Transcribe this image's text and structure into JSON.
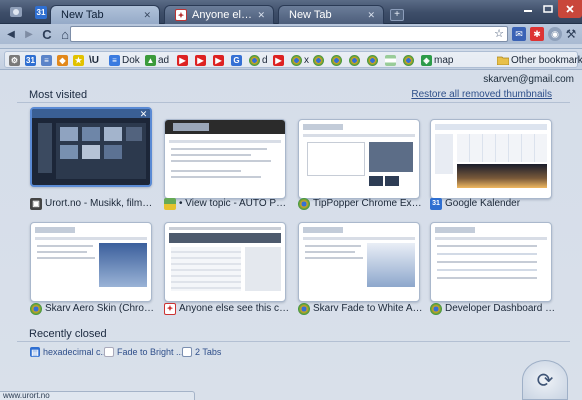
{
  "window": {
    "tabs": [
      {
        "title": "New Tab",
        "active": true,
        "favicon": "new-tab"
      },
      {
        "title": "Anyone else see this...",
        "active": false,
        "favicon": "news"
      },
      {
        "title": "New Tab",
        "active": false,
        "favicon": "new-tab"
      }
    ],
    "new_tab_glyph": "+",
    "app_badge": "31"
  },
  "toolbar": {
    "back": "◀",
    "forward": "▶",
    "reload": "C",
    "home": "⌂",
    "omnibox_value": "",
    "star": "☆",
    "wrench": "⚒"
  },
  "bookmarks": [
    {
      "label": "",
      "icon": "gear-icon",
      "color": "#7a7a7a"
    },
    {
      "label": "",
      "icon": "calendar-icon",
      "color": "#2f6fd1"
    },
    {
      "label": "",
      "icon": "docs-icon",
      "color": "#5b84c9"
    },
    {
      "label": "",
      "icon": "orange-icon",
      "color": "#e2881b"
    },
    {
      "label": "",
      "icon": "star-icon",
      "color": "#e2c200"
    },
    {
      "label": "\\U",
      "icon": "",
      "color": ""
    },
    {
      "label": "Dok",
      "icon": "docs-icon",
      "color": "#3a7be0"
    },
    {
      "label": "ad",
      "icon": "ads-icon",
      "color": "#3b9b3b"
    },
    {
      "label": "",
      "icon": "youtube-icon",
      "color": "#d22"
    },
    {
      "label": "",
      "icon": "youtube-icon",
      "color": "#d22"
    },
    {
      "label": "",
      "icon": "youtube-icon",
      "color": "#d22"
    },
    {
      "label": "",
      "icon": "google-icon",
      "color": "#3570d4"
    },
    {
      "label": "d",
      "icon": "chrome-icon",
      "color": "#e2a51b"
    },
    {
      "label": "",
      "icon": "youtube-icon",
      "color": "#d22"
    },
    {
      "label": "x",
      "icon": "chrome-icon",
      "color": "#2d9b49"
    },
    {
      "label": "",
      "icon": "chrome-icon",
      "color": "#2d9b49"
    },
    {
      "label": "",
      "icon": "chrome-icon",
      "color": "#2d9b49"
    },
    {
      "label": "",
      "icon": "chrome-icon",
      "color": "#2d9b49"
    },
    {
      "label": "",
      "icon": "flag-icon",
      "color": "#9c9"
    },
    {
      "label": "",
      "icon": "chrome-icon",
      "color": "#2d9b49"
    },
    {
      "label": "map",
      "icon": "maps-icon",
      "color": "#2d9b49"
    }
  ],
  "other_bookmarks_label": "Other bookmarks",
  "account_email": "skarven@gmail.com",
  "most_visited": {
    "title": "Most visited",
    "restore_label": "Restore all removed thumbnails",
    "items": [
      {
        "title": "Urort.no - Musikk, filmmusikk...",
        "favicon_color": "#444"
      },
      {
        "title": "• View topic - AUTO POP-UP...",
        "favicon_color": "#6a5"
      },
      {
        "title": "TipPopper Chrome Extension -...",
        "favicon_color": "#e2a51b"
      },
      {
        "title": "Google Kalender",
        "favicon_color": "#2f6fd1"
      },
      {
        "title": "Skarv Aero Skin (Chrome The...",
        "favicon_color": "#e2a51b"
      },
      {
        "title": "Anyone else see this crazy ta...",
        "favicon_color": "#c33"
      },
      {
        "title": "Skarv Fade to White Aero Ski...",
        "favicon_color": "#e2a51b"
      },
      {
        "title": "Developer Dashboard - Googl...",
        "favicon_color": "#e2a51b"
      }
    ]
  },
  "recently_closed": {
    "title": "Recently closed",
    "items": [
      {
        "label": "hexadecimal c...",
        "favicon_color": "#2f6fd1"
      },
      {
        "label": "Fade to Bright ...",
        "favicon_color": "#bbb"
      },
      {
        "label": "2 Tabs",
        "favicon_color": "#fff"
      }
    ]
  },
  "status_text": "www.urort.no"
}
